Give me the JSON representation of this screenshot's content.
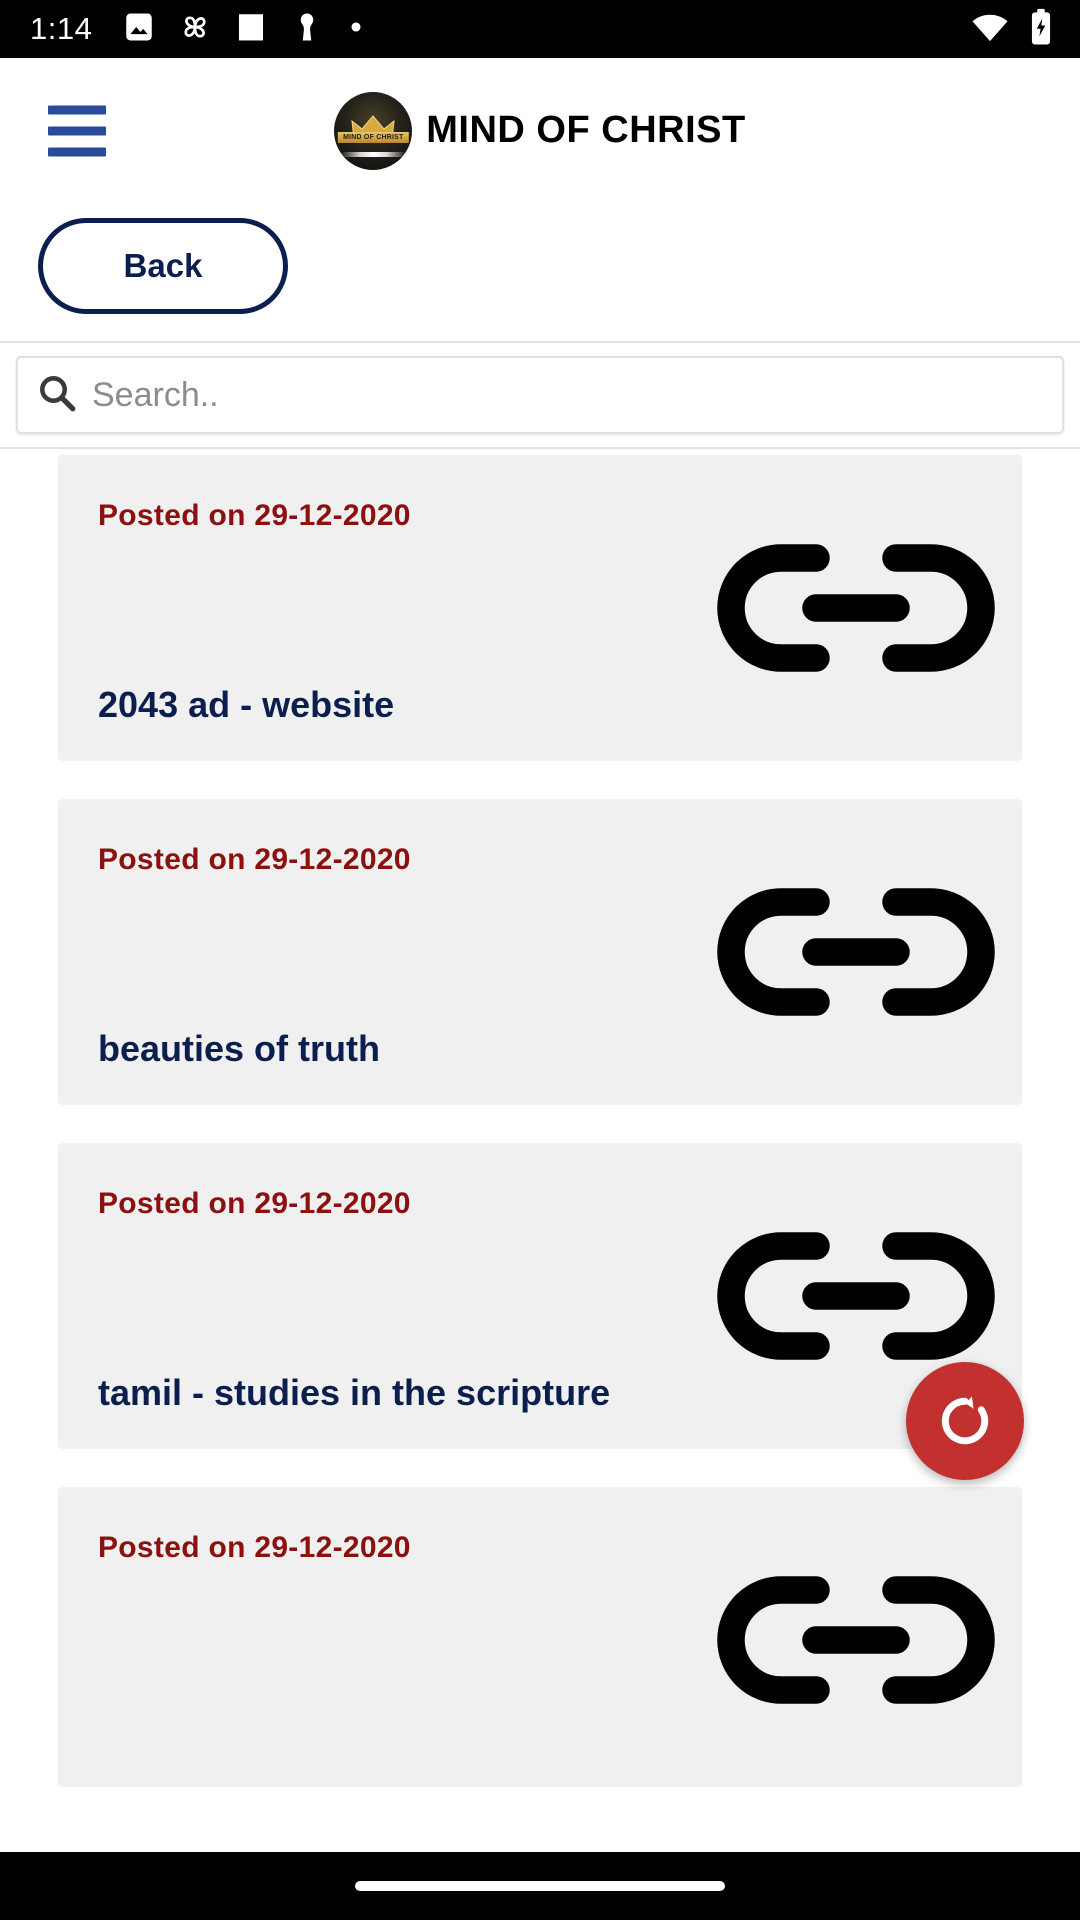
{
  "status_bar": {
    "clock": "1:14",
    "left_icons": [
      "image-icon",
      "pinwheel-icon",
      "square-icon",
      "keyhole-icon",
      "dot-icon"
    ],
    "right_icons": [
      "wifi-icon",
      "battery-charging-icon"
    ],
    "background": "#000000"
  },
  "header": {
    "menu_icon": "hamburger-menu-icon",
    "menu_color": "#2a4b9b",
    "logo_alt": "mind-of-christ-logo",
    "logo_banner_text": "MIND OF CHRIST",
    "title": "MIND OF CHRIST"
  },
  "back_button": {
    "label": "Back",
    "border_color": "#0b1f4f",
    "text_color": "#0b1f4f"
  },
  "search": {
    "placeholder": "Search..",
    "value": "",
    "icon": "search-icon"
  },
  "colors": {
    "date_text": "#8c1010",
    "title_text": "#0b1f4f",
    "card_background": "#f0f0f0",
    "fab_background": "#c2312f",
    "accent_blue": "#2a4b9b"
  },
  "list": {
    "items": [
      {
        "date": "Posted on 29-12-2020",
        "title": "2043 ad - website",
        "icon": "link-chain-icon"
      },
      {
        "date": "Posted on 29-12-2020",
        "title": "beauties of truth",
        "icon": "link-chain-icon"
      },
      {
        "date": "Posted on 29-12-2020",
        "title": "tamil - studies in the scripture",
        "icon": "link-chain-icon"
      },
      {
        "date": "Posted on 29-12-2020",
        "title": "",
        "icon": "link-chain-icon"
      }
    ]
  },
  "fab": {
    "icon": "refresh-icon",
    "label": "Refresh"
  },
  "nav_bar": {
    "gesture_pill": "home-indicator"
  }
}
